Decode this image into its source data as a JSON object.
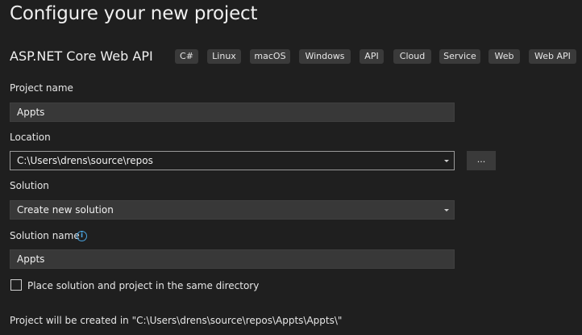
{
  "title": "Configure your new project",
  "template": {
    "name": "ASP.NET Core Web API",
    "tags": [
      "C#",
      "Linux",
      "macOS",
      "Windows",
      "API",
      "Cloud",
      "Service",
      "Web",
      "Web API"
    ]
  },
  "project_name": {
    "label": "Project name",
    "value": "Appts"
  },
  "location": {
    "label": "Location",
    "value": "C:\\Users\\drens\\source\\repos",
    "browse_label": "..."
  },
  "solution": {
    "label": "Solution",
    "value": "Create new solution"
  },
  "solution_name": {
    "label": "Solution name",
    "info_icon": "i",
    "value": "Appts"
  },
  "same_dir": {
    "label": "Place solution and project in the same directory",
    "checked": false
  },
  "footer": "Project will be created in \"C:\\Users\\drens\\source\\repos\\Appts\\Appts\\\""
}
